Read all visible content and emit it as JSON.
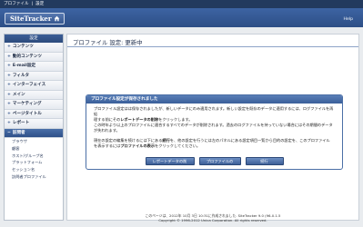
{
  "topbar": {
    "item1": "プロファイル",
    "sep": "|",
    "item2": "設定"
  },
  "header": {
    "logo_text": "SiteTracker",
    "help_label": "Help"
  },
  "sidebar": {
    "header": "設定",
    "items": [
      {
        "label": "コンテンツ"
      },
      {
        "label": "動的コンテンツ"
      },
      {
        "label": "E-mail設定"
      },
      {
        "label": "フィルタ"
      },
      {
        "label": "インターフェイス"
      },
      {
        "label": "メイン"
      },
      {
        "label": "マーケティング"
      },
      {
        "label": "ページタイトル"
      },
      {
        "label": "レポート"
      }
    ],
    "active_item": "訪問者",
    "sub_items": [
      "ブラウザ",
      "顧客",
      "ホスト/グループ名",
      "プラットフォーム",
      "セッション名",
      "訪問者プロファイル"
    ]
  },
  "main": {
    "title": "プロファイル 設定: 更新中"
  },
  "dialog": {
    "heading": "プロファイル設定が保存されました",
    "p1_a": "プロファイル設定はは保存されましたが、新しいデータにのみ適用されます。新しい設定を既存のデータに適用するには、ログファイルを再処",
    "p1_b": "理する前にその",
    "p1_bold": "レポートデータの削除",
    "p1_c": "をクリックします。",
    "p1_d": "この時年より以上のプロファイルに適合するすべてのデータが削除されます。過去のログファイルを持っていない場合にはその期間のデータ",
    "p1_e": "が失われます。",
    "p2_a": "現在の設定の編集を続けるには下にある",
    "p2_bold1": "続行",
    "p2_b": "を、他の設定を行うには左のパネルにある設定項目一覧から目的の設定を、このプロファイル",
    "p2_c": "を表示するには",
    "p2_bold2": "プロファイルの表示",
    "p2_d": "をクリックしてください。",
    "buttons": [
      "レポートデータの削除",
      "プロファイルの表示",
      "続行"
    ]
  },
  "footer": {
    "line1": "このページは、2012年 10月 3日 10:31に作成されました. SiteTracker 9.0 (96-0.1.5",
    "line2": "Copyright © 1996-2012 Unica Corporation. All rights reserved."
  }
}
